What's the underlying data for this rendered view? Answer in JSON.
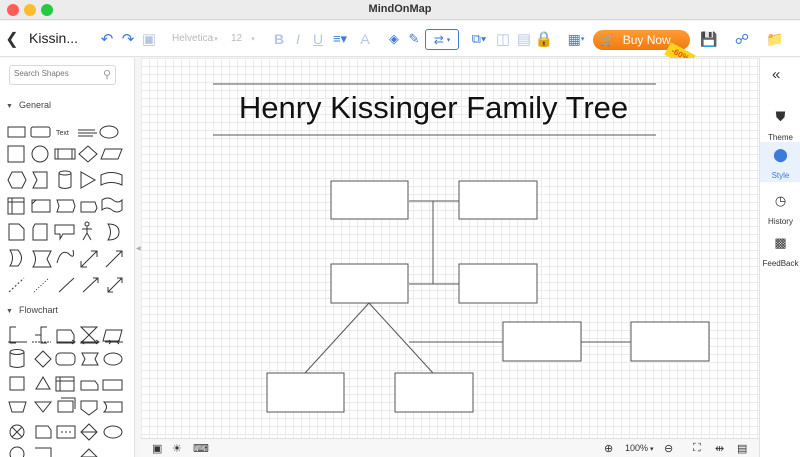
{
  "window": {
    "title": "MindOnMap"
  },
  "toolbar": {
    "doc_title": "Kissin...",
    "font_name": "Helvetica",
    "font_size": "12",
    "buy_label": "Buy Now",
    "discount_badge": "-60%"
  },
  "left_panel": {
    "search_placeholder": "Search Shapes",
    "sections": {
      "general": "General",
      "flowchart": "Flowchart"
    },
    "text_shape_label": "Text"
  },
  "canvas": {
    "title": "Henry Kissinger Family Tree",
    "boxes": [
      "",
      "",
      "",
      "",
      "",
      "",
      "",
      ""
    ]
  },
  "statusbar": {
    "zoom": "100%"
  },
  "right_panel": {
    "items": [
      {
        "label": "Theme",
        "icon": "shirt-icon"
      },
      {
        "label": "Style",
        "icon": "palette-icon"
      },
      {
        "label": "History",
        "icon": "clock-icon"
      },
      {
        "label": "FeedBack",
        "icon": "chat-icon"
      }
    ],
    "active": "Style"
  },
  "colors": {
    "accent": "#3d7bd9",
    "buy_button": "#f58a1f",
    "canvas_grid": "#ebebeb"
  }
}
